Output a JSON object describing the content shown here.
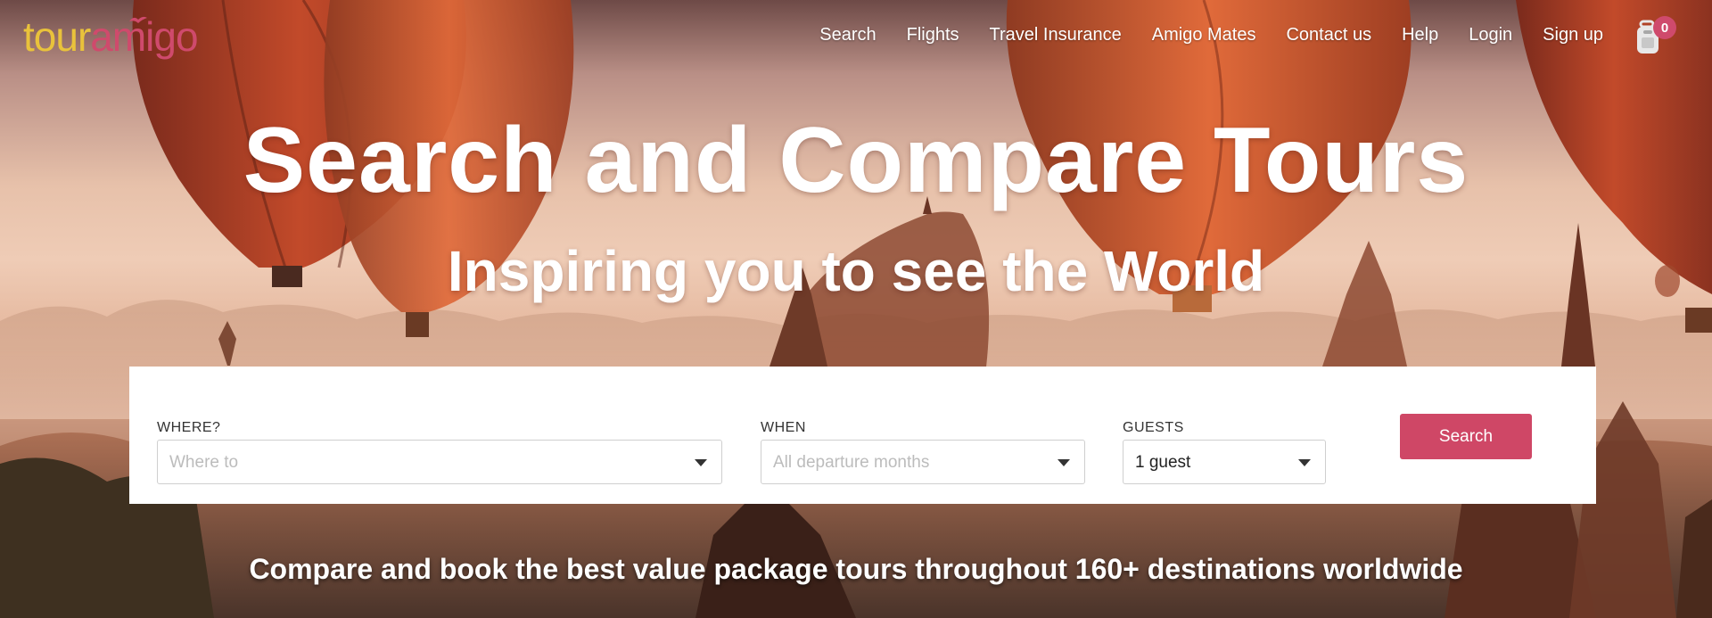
{
  "logo": {
    "part1": "tour",
    "part2": "amigo"
  },
  "nav": {
    "items": [
      "Search",
      "Flights",
      "Travel Insurance",
      "Amigo Mates",
      "Contact us",
      "Help",
      "Login",
      "Sign up"
    ]
  },
  "cart": {
    "count": "0",
    "icon": "backpack-icon"
  },
  "hero": {
    "title": "Search and Compare Tours",
    "subtitle": "Inspiring you to see the World",
    "tagline": "Compare and book the best value package tours throughout 160+ destinations worldwide"
  },
  "search": {
    "where_label": "WHERE?",
    "where_placeholder": "Where to",
    "when_label": "WHEN",
    "when_placeholder": "All departure months",
    "guests_label": "GUESTS",
    "guests_value": "1 guest",
    "button_label": "Search"
  },
  "colors": {
    "brand_yellow": "#e9c23b",
    "brand_pink": "#cf4a6c",
    "button": "#cf4766"
  }
}
